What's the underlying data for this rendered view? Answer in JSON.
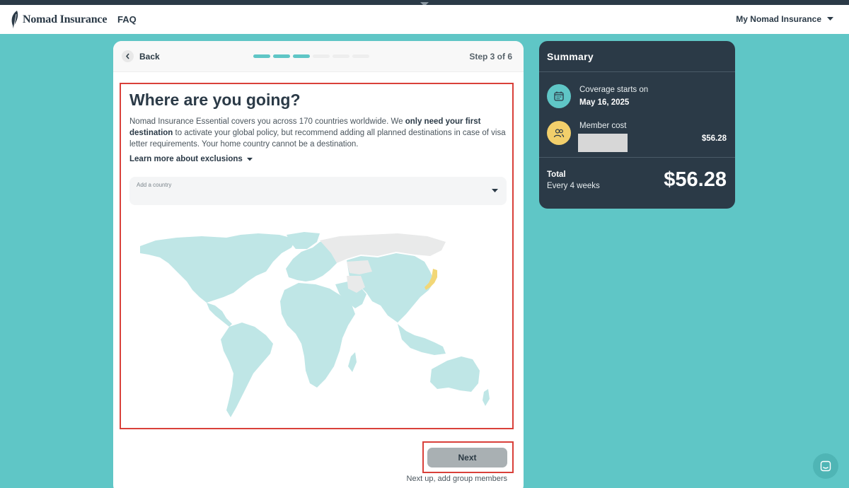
{
  "header": {
    "brand": "Nomad Insurance",
    "faq": "FAQ",
    "account_menu": "My Nomad Insurance"
  },
  "wizard": {
    "back": "Back",
    "step_label": "Step 3 of 6",
    "steps_total": 6,
    "steps_done": 3
  },
  "main": {
    "title": "Where are you going?",
    "desc_1": "Nomad Insurance Essential covers you across 170 countries worldwide. We ",
    "desc_bold_1": "only need your first destination",
    "desc_2": " to activate your global policy, but recommend adding all planned destinations in case of visa letter requirements. Your home country cannot be a destination.",
    "learn_more": "Learn more about exclusions",
    "country_select": {
      "label": "Add a country",
      "value": ""
    },
    "next_button": "Next",
    "next_up": "Next up, add group members"
  },
  "summary": {
    "title": "Summary",
    "coverage_label": "Coverage starts on",
    "coverage_date": "May 16, 2025",
    "member_label": "Member cost",
    "member_price": "$56.28",
    "total_label": "Total",
    "total_period": "Every 4 weeks",
    "total_amount": "$56.28"
  },
  "colors": {
    "accent": "#5fc6c6",
    "dark": "#2b3a47",
    "map_covered": "#bfe6e6",
    "map_excluded": "#e9eaea",
    "map_selected": "#f2d777",
    "highlight": "#d9403a"
  },
  "icons": {
    "brand_logo": "feather-icon",
    "notch": "chevron-down-icon",
    "back": "chevron-left-icon",
    "coverage": "calendar-icon",
    "member": "users-icon",
    "chat": "chat-icon"
  }
}
